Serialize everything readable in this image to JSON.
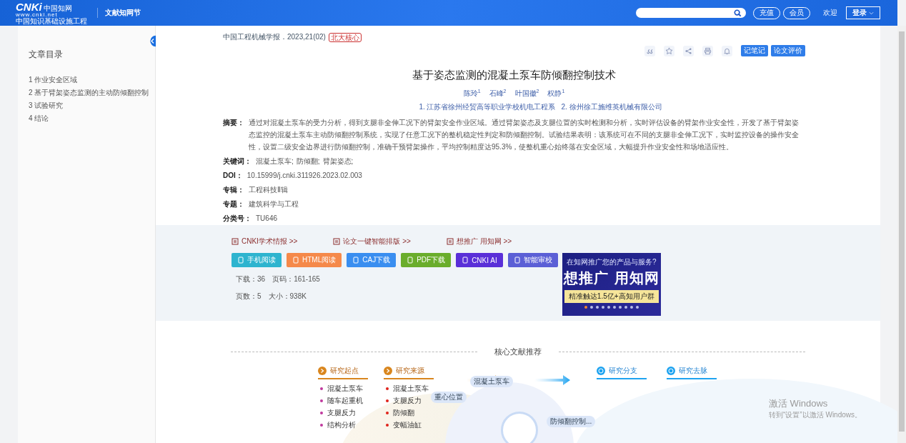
{
  "header": {
    "logo_mark": "CNKi",
    "logo_cn": "中国知网",
    "logo_url": "www.cnki.net",
    "logo_tagline": "中国知识基础设施工程",
    "section": "文献知网节",
    "buttons": [
      "充值",
      "会员"
    ],
    "welcome": "欢迎",
    "login": "登录"
  },
  "sidebar": {
    "title": "文章目录",
    "items": [
      "1 作业安全区域",
      "2 基于臂架姿态监测的主动防倾翻控制",
      "3 试验研究",
      "4 结论"
    ]
  },
  "article": {
    "source": "中国工程机械学报．2023,21(02)",
    "badge": "北大核心",
    "actions": [
      "记笔记",
      "论文评价"
    ],
    "title": "基于姿态监测的混凝土泵车防倾翻控制技术",
    "authors": [
      {
        "name": "陈玲",
        "sup": "1"
      },
      {
        "name": "石峰",
        "sup": "2"
      },
      {
        "name": "叶国徽",
        "sup": "2"
      },
      {
        "name": "权静",
        "sup": "1"
      }
    ],
    "affiliations": [
      "1. 江苏省徐州经贸高等职业学校机电工程系",
      "2. 徐州徐工施维英机械有限公司"
    ],
    "fields": [
      {
        "label": "摘要：",
        "value": "通过对混凝土泵车的受力分析，得到支腿非全伸工况下的臂架安全作业区域。通过臂架姿态及支腿位置的实时检测和分析，实时评估设备的臂架作业安全性，开发了基于臂架姿态监控的混凝土泵车主动防倾翻控制系统，实现了任意工况下的整机稳定性判定和防倾翻控制。试验结果表明：该系统可在不同的支腿非全伸工况下，实时监控设备的操作安全性，设置二级安全边界进行防倾翻控制，准确干预臂架操作，平均控制精度达95.3%，使整机重心始终落在安全区域，大幅提升作业安全性和场地适应性。"
      },
      {
        "label": "关键词：",
        "keywords": [
          "混凝土泵车;",
          "防倾翻;",
          "臂架姿态;"
        ]
      },
      {
        "label": "DOI：",
        "value": "10.15999/j.cnki.311926.2023.02.003"
      },
      {
        "label": "专辑：",
        "value": "工程科技Ⅱ辑"
      },
      {
        "label": "专题：",
        "value": "建筑科学与工程"
      },
      {
        "label": "分类号：",
        "value": "TU646"
      }
    ]
  },
  "tools": {
    "links": [
      "CNKI学术情报 >>",
      "论文一键智能排版 >>",
      "想推广 用知网 >>"
    ],
    "buttons": [
      {
        "label": "手机阅读",
        "color": "#2eb4cf"
      },
      {
        "label": "HTML阅读",
        "color": "#f5894a"
      },
      {
        "label": "CAJ下载",
        "color": "#3a8ef0"
      },
      {
        "label": "PDF下载",
        "color": "#6aad2c"
      },
      {
        "label": "CNKI AI",
        "color": "#5a2fd8"
      },
      {
        "label": "智能审校",
        "color": "#5b5fd6"
      }
    ],
    "stats": [
      [
        "下载：36",
        "页码：161-165"
      ],
      [
        "页数：5",
        "大小：938K"
      ]
    ],
    "ad": {
      "line1": "在知网推广您的产品与服务?",
      "line2": "想推广 用知网",
      "line3": "精准触达1.5亿+高知用户群",
      "slides": [
        {
          "selected": true
        },
        {
          "selected": false
        },
        {
          "selected": false
        },
        {
          "selected": false
        },
        {
          "selected": false
        },
        {
          "selected": false
        },
        {
          "selected": false
        },
        {
          "selected": false
        },
        {
          "selected": false
        },
        {
          "selected": false
        }
      ]
    }
  },
  "recommend": {
    "heading": "核心文献推荐",
    "columns": [
      {
        "title": "研究起点",
        "color": "#c0399e",
        "items": [
          "混凝土泵车",
          "随车起重机",
          "支腿反力",
          "结构分析"
        ]
      },
      {
        "title": "研究来源",
        "color": "#e0231b",
        "items": [
          "混凝土泵车",
          "支腿反力",
          "防倾翻",
          "变幅油缸"
        ]
      }
    ],
    "branches": [
      "研究分支",
      "研究去脉"
    ],
    "bubbles": [
      "混凝土泵车",
      "重心位置",
      "防倾翻控制..."
    ]
  },
  "os_notice": {
    "title": "激活 Windows",
    "subtitle": "转到“设置”以激活 Windows。"
  }
}
